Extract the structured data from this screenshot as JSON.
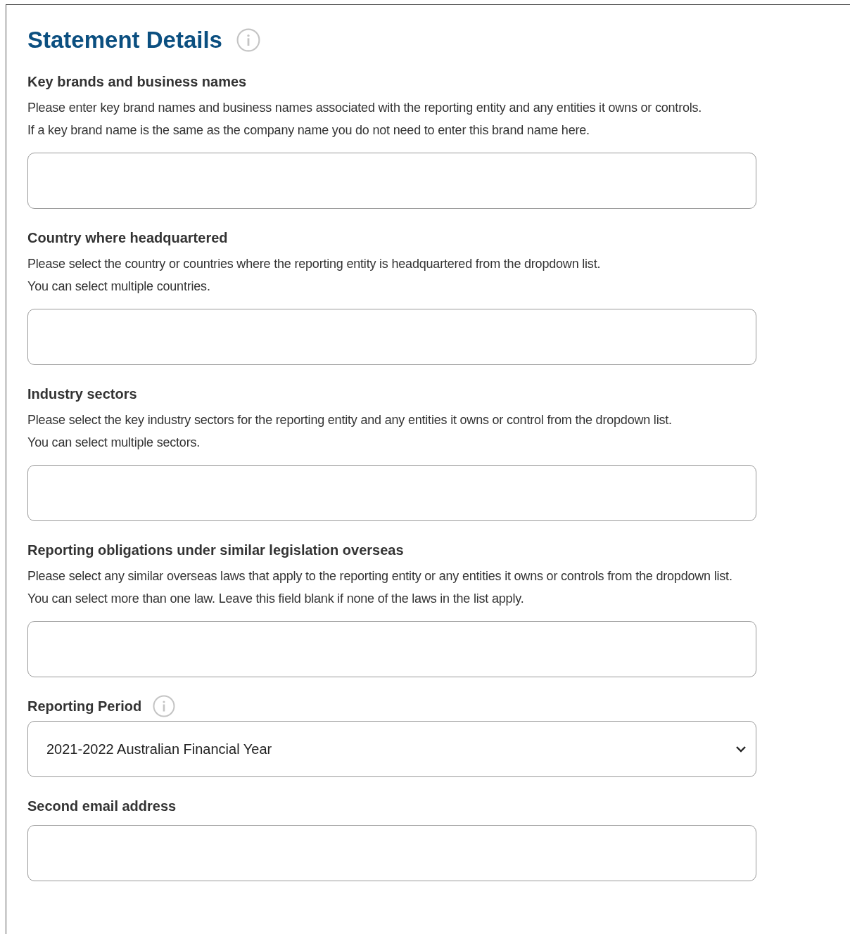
{
  "title": "Statement Details",
  "fields": [
    {
      "kind": "text",
      "label": "Key brands and business names",
      "info": false,
      "description": [
        "Please enter key brand names and business names associated with the reporting entity and any entities it owns or controls.",
        "If a key brand name is the same as the company name you do not need to enter this brand name here."
      ]
    },
    {
      "kind": "text",
      "label": "Country where headquartered",
      "info": false,
      "description": [
        "Please select the country or countries where the reporting entity is headquartered from the dropdown list.",
        "You can select multiple countries."
      ]
    },
    {
      "kind": "text",
      "label": "Industry sectors",
      "info": false,
      "description": [
        "Please select the key industry sectors for the reporting entity and any entities it owns or control from the dropdown list.",
        "You can select multiple sectors."
      ]
    },
    {
      "kind": "text",
      "label": "Reporting obligations under similar legislation overseas",
      "info": false,
      "description": [
        "Please select any similar overseas laws that apply to the reporting entity or any entities it owns or controls from the dropdown list.",
        "You can select more than one law. Leave this field blank if none of the laws in the list apply."
      ]
    },
    {
      "kind": "select",
      "label": "Reporting Period",
      "info": true,
      "value": "2021-2022 Australian Financial Year"
    },
    {
      "kind": "text",
      "label": "Second email address",
      "info": false
    }
  ]
}
